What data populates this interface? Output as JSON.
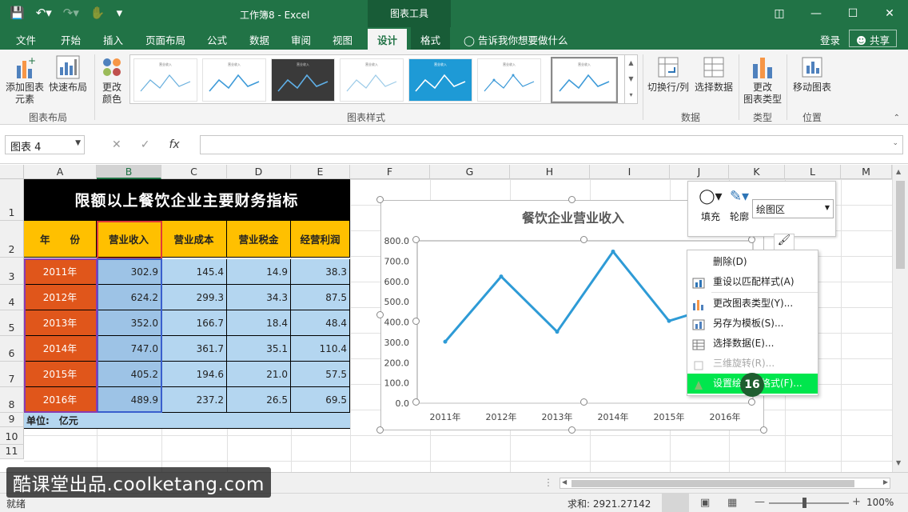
{
  "window": {
    "title": "工作簿8 - Excel",
    "chart_tools_label": "图表工具",
    "controls": [
      "□",
      "—",
      "☐",
      "✕"
    ]
  },
  "tabs": {
    "file": "文件",
    "home": "开始",
    "insert": "插入",
    "page_layout": "页面布局",
    "formulas": "公式",
    "data": "数据",
    "review": "审阅",
    "view": "视图",
    "design": "设计",
    "format": "格式",
    "tell_me": "告诉我你想要做什么",
    "login": "登录",
    "share": "共享"
  },
  "ribbon": {
    "add_element_line1": "添加图表",
    "add_element_line2": "元素",
    "quick_layout": "快速布局",
    "change_colors_line1": "更改",
    "change_colors_line2": "颜色",
    "group_layout": "图表布局",
    "group_styles": "图表样式",
    "switch_row_col": "切换行/列",
    "select_data": "选择数据",
    "group_data": "数据",
    "change_type_line1": "更改",
    "change_type_line2": "图表类型",
    "group_type": "类型",
    "move_chart": "移动图表",
    "group_location": "位置",
    "thumb_title": "营业收入"
  },
  "formula_bar": {
    "name_box": "图表 4",
    "cancel": "✕",
    "enter": "✓",
    "fx": "fx"
  },
  "columns": [
    "A",
    "B",
    "C",
    "D",
    "E",
    "F",
    "G",
    "H",
    "I",
    "J",
    "K",
    "L",
    "M"
  ],
  "rows": [
    "1",
    "2",
    "3",
    "4",
    "5",
    "6",
    "7",
    "8",
    "9",
    "10",
    "11"
  ],
  "table": {
    "title": "限额以上餐饮企业主要财务指标",
    "headers": [
      "年　　份",
      "营业收入",
      "营业成本",
      "营业税金",
      "经营利润"
    ],
    "data": [
      [
        "2011年",
        "302.9",
        "145.4",
        "14.9",
        "38.3"
      ],
      [
        "2012年",
        "624.2",
        "299.3",
        "34.3",
        "87.5"
      ],
      [
        "2013年",
        "352.0",
        "166.7",
        "18.4",
        "48.4"
      ],
      [
        "2014年",
        "747.0",
        "361.7",
        "35.1",
        "110.4"
      ],
      [
        "2015年",
        "405.2",
        "194.6",
        "21.0",
        "57.5"
      ],
      [
        "2016年",
        "489.9",
        "237.2",
        "26.5",
        "69.5"
      ]
    ],
    "unit": "单位:　亿元"
  },
  "chart_data": {
    "type": "line",
    "title": "餐饮企业营业收入",
    "categories": [
      "2011年",
      "2012年",
      "2013年",
      "2014年",
      "2015年",
      "2016年"
    ],
    "values": [
      302.9,
      624.2,
      352.0,
      747.0,
      405.2,
      489.9
    ],
    "ylim": [
      0,
      800
    ],
    "yticks": [
      "0.0",
      "100.0",
      "200.0",
      "300.0",
      "400.0",
      "500.0",
      "600.0",
      "700.0",
      "800.0"
    ],
    "line_color": "#2e9bd6",
    "grid": false,
    "legend": "none"
  },
  "float_toolbar": {
    "fill": "填充",
    "outline": "轮廓",
    "element": "绘图区"
  },
  "context_menu": {
    "delete": "删除(D)",
    "reset": "重设以匹配样式(A)",
    "change_type": "更改图表类型(Y)...",
    "save_template": "另存为模板(S)...",
    "select_data": "选择数据(E)...",
    "rotation": "三维旋转(R)...",
    "format": "设置绘图区格式(F)..."
  },
  "step_badge": "16",
  "status": {
    "ready": "就绪",
    "sum": "求和: 2921.27142",
    "zoom": "100%"
  },
  "watermark": "酷课堂出品.coolketang.com",
  "colors": {
    "excel_green": "#217346",
    "title_black": "#000000",
    "header_orange": "#ffc000",
    "year_red": "#e0561b",
    "value_blue": "#b4d6f0",
    "menu_highlight": "#00e64d"
  }
}
